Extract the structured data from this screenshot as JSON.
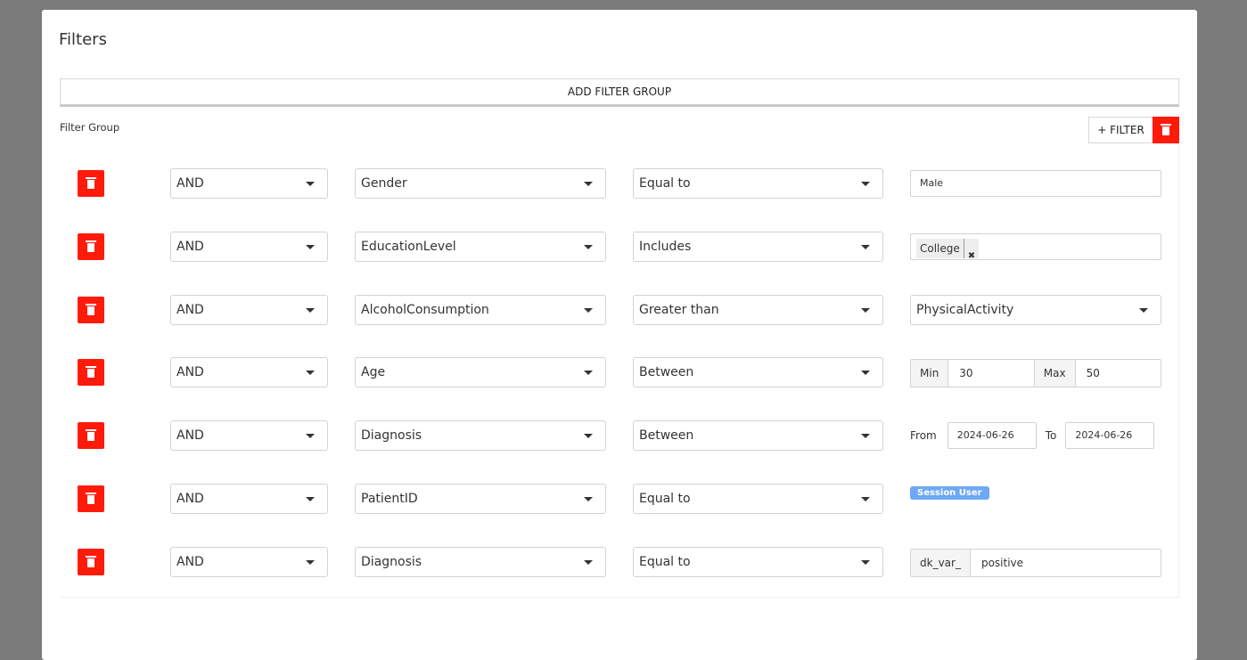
{
  "title": "Filters",
  "add_filter_group": "ADD FILTER GROUP",
  "group": {
    "label": "Filter Group",
    "add_filter": "+ FILTER"
  },
  "colors": {
    "danger": "#ff1a0a",
    "badge": "#6fa8f5"
  },
  "rows": [
    {
      "logic": "AND",
      "field": "Gender",
      "operator": "Equal to",
      "value": "Male"
    },
    {
      "logic": "AND",
      "field": "EducationLevel",
      "operator": "Includes",
      "tag": "College"
    },
    {
      "logic": "AND",
      "field": "AlcoholConsumption",
      "operator": "Greater than",
      "value_field": "PhysicalActivity"
    },
    {
      "logic": "AND",
      "field": "Age",
      "operator": "Between",
      "min_label": "Min",
      "min": "30",
      "max_label": "Max",
      "max": "50"
    },
    {
      "logic": "AND",
      "field": "Diagnosis",
      "operator": "Between",
      "from_label": "From",
      "from": "2024-06-26",
      "to_label": "To",
      "to": "2024-06-26"
    },
    {
      "logic": "AND",
      "field": "PatientID",
      "operator": "Equal to",
      "badge": "Session User"
    },
    {
      "logic": "AND",
      "field": "Diagnosis",
      "operator": "Equal to",
      "prefix": "dk_var_",
      "value": "positive"
    }
  ]
}
